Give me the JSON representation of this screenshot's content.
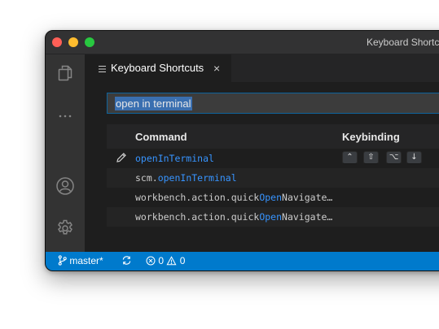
{
  "window": {
    "title": "Keyboard Shortcuts"
  },
  "activity_bar": {
    "items": [
      "explorer-icon",
      "more-icon",
      "account-icon",
      "settings-gear-icon"
    ]
  },
  "tab": {
    "icon": "keyboard-shortcuts-icon",
    "label": "Keyboard Shortcuts",
    "close": "×"
  },
  "search": {
    "value": "open in terminal"
  },
  "table": {
    "headers": {
      "command": "Command",
      "keybinding": "Keybinding"
    },
    "rows": [
      {
        "pre": "",
        "match": "openInTerminal",
        "post": "",
        "keys": [
          "⌃",
          "⇧",
          "⌥",
          "↓"
        ],
        "edit_icon": "pencil-icon"
      },
      {
        "pre": "scm.",
        "match": "openInTerminal",
        "post": "",
        "keys": []
      },
      {
        "pre": "workbench.action.quick",
        "match": "Open",
        "post": "Navigate…",
        "keys": []
      },
      {
        "pre": "workbench.action.quick",
        "match": "Open",
        "post": "Navigate…",
        "keys": []
      }
    ]
  },
  "status_bar": {
    "branch": "master*",
    "errors": "0",
    "warnings": "0"
  },
  "colors": {
    "status_bar": "#007acc",
    "highlight": "#3794ff",
    "search_border": "#0e639c"
  }
}
